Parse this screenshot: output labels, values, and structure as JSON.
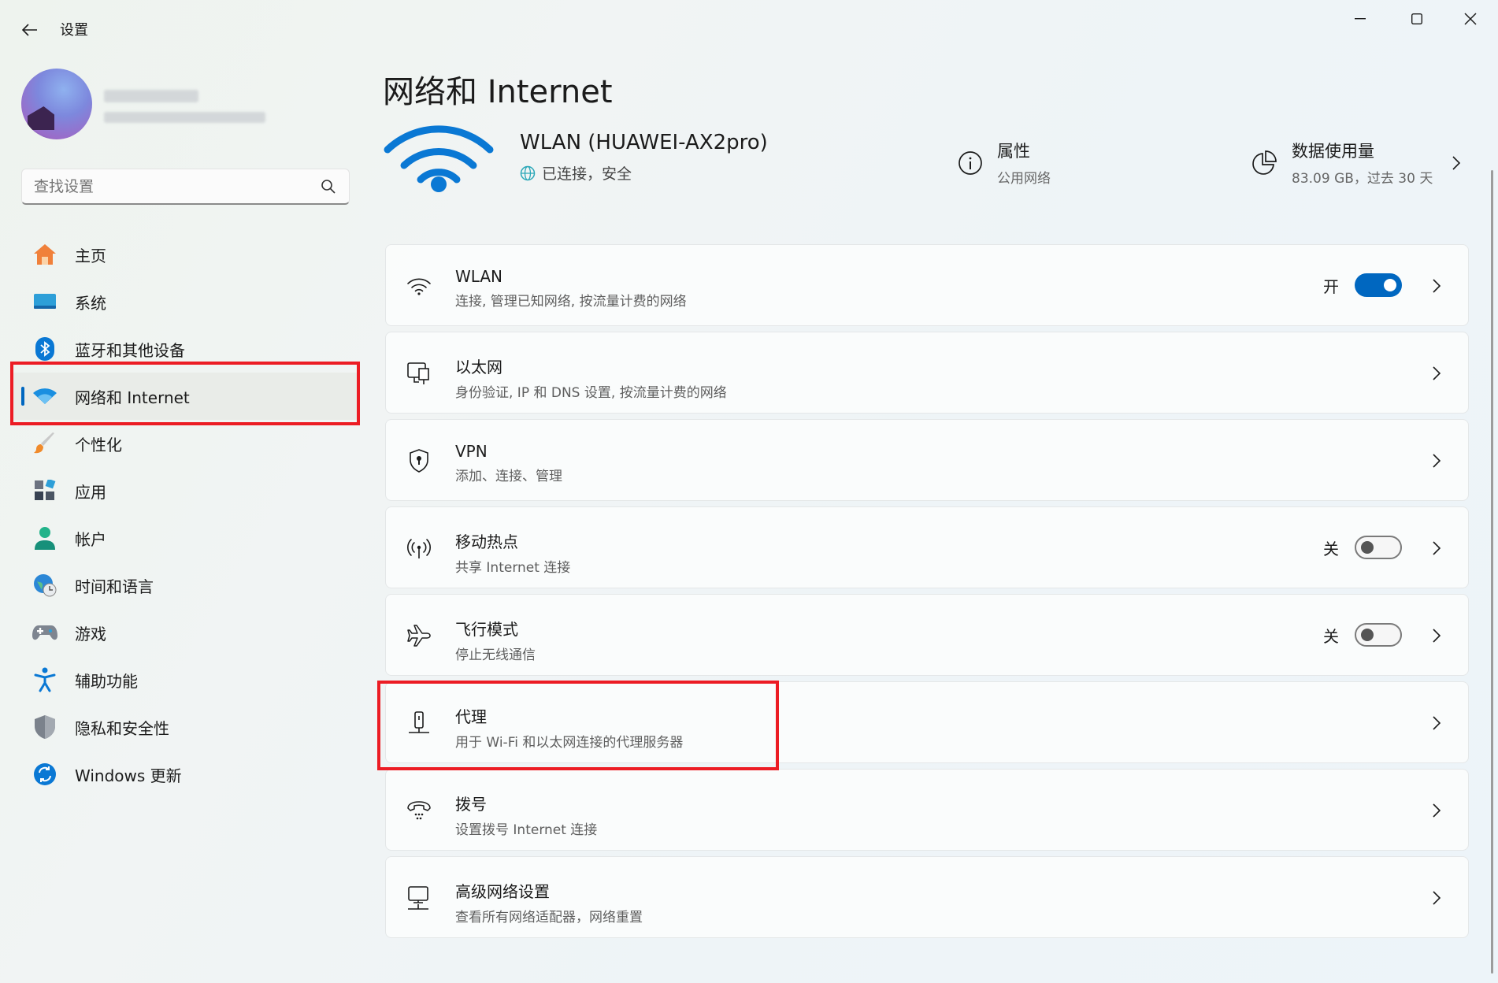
{
  "window": {
    "title": "设置"
  },
  "search": {
    "placeholder": "查找设置"
  },
  "sidebar": {
    "items": [
      {
        "label": "主页",
        "icon": "home-icon"
      },
      {
        "label": "系统",
        "icon": "system-icon"
      },
      {
        "label": "蓝牙和其他设备",
        "icon": "bluetooth-icon"
      },
      {
        "label": "网络和 Internet",
        "icon": "network-icon",
        "active": true
      },
      {
        "label": "个性化",
        "icon": "brush-icon"
      },
      {
        "label": "应用",
        "icon": "apps-icon"
      },
      {
        "label": "帐户",
        "icon": "account-icon"
      },
      {
        "label": "时间和语言",
        "icon": "clock-globe-icon"
      },
      {
        "label": "游戏",
        "icon": "gamepad-icon"
      },
      {
        "label": "辅助功能",
        "icon": "accessibility-icon"
      },
      {
        "label": "隐私和安全性",
        "icon": "shield-icon"
      },
      {
        "label": "Windows 更新",
        "icon": "update-icon"
      }
    ]
  },
  "main": {
    "title": "网络和 Internet",
    "connection": {
      "name": "WLAN (HUAWEI-AX2pro)",
      "status": "已连接，安全"
    },
    "properties": {
      "title": "属性",
      "subtitle": "公用网络"
    },
    "data_usage": {
      "title": "数据使用量",
      "subtitle": "83.09 GB，过去 30 天"
    },
    "cards": [
      {
        "title": "WLAN",
        "subtitle": "连接, 管理已知网络, 按流量计费的网络",
        "toggle_label": "开",
        "toggle_on": true
      },
      {
        "title": "以太网",
        "subtitle": "身份验证, IP 和 DNS 设置, 按流量计费的网络"
      },
      {
        "title": "VPN",
        "subtitle": "添加、连接、管理"
      },
      {
        "title": "移动热点",
        "subtitle": "共享 Internet 连接",
        "toggle_label": "关",
        "toggle_on": false
      },
      {
        "title": "飞行模式",
        "subtitle": "停止无线通信",
        "toggle_label": "关",
        "toggle_on": false
      },
      {
        "title": "代理",
        "subtitle": "用于 Wi-Fi 和以太网连接的代理服务器"
      },
      {
        "title": "拨号",
        "subtitle": "设置拨号 Internet 连接"
      },
      {
        "title": "高级网络设置",
        "subtitle": "查看所有网络适配器，网络重置"
      }
    ]
  },
  "colors": {
    "accent": "#0067c0",
    "highlight": "#ec1c24"
  }
}
